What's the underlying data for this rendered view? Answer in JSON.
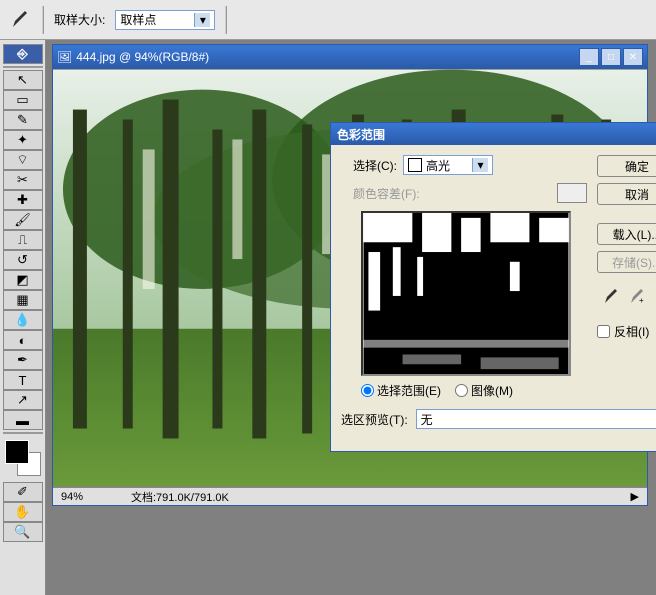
{
  "option_bar": {
    "sample_size_label": "取样大小:",
    "sample_size_value": "取样点"
  },
  "toolbox": {
    "tools": [
      "move",
      "marquee",
      "lasso",
      "wand",
      "crop",
      "slice",
      "heal",
      "brush",
      "stamp",
      "history",
      "eraser",
      "gradient",
      "blur",
      "dodge",
      "pen",
      "type",
      "path",
      "shape",
      "notes",
      "eyedrop",
      "hand",
      "zoom"
    ]
  },
  "document": {
    "title": "444.jpg @ 94%(RGB/8#)",
    "zoom": "94%",
    "status_doc": "文档:791.0K/791.0K"
  },
  "dialog": {
    "title": "色彩范围",
    "select_label": "选择(C):",
    "select_value": "高光",
    "fuzziness_label": "颜色容差(F):",
    "radio_selection": "选择范围(E)",
    "radio_image": "图像(M)",
    "preview_label": "选区预览(T):",
    "preview_value": "无",
    "btn_ok": "确定",
    "btn_cancel": "取消",
    "btn_load": "载入(L)...",
    "btn_save": "存储(S)...",
    "invert_label": "反相(I)"
  }
}
